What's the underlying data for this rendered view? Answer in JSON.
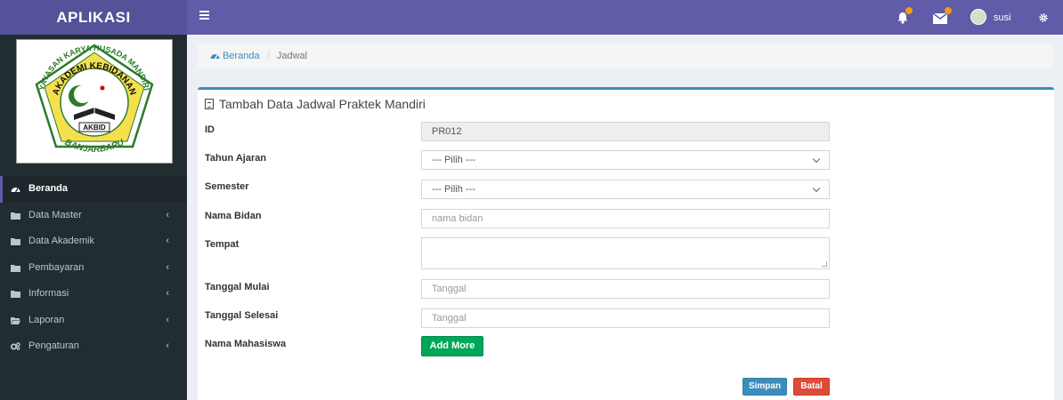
{
  "header": {
    "app_title": "APLIKASI",
    "user_name": "susi"
  },
  "logo": {
    "ring_text": "YAYASAN KARYA HUSADA MANDIRI",
    "inner_text": "AKADEMI KEBIDANAN",
    "badge_text": "AKBID",
    "city_text": "BANJARBARU"
  },
  "sidebar": {
    "items": [
      {
        "label": "Beranda",
        "icon": "dashboard-icon"
      },
      {
        "label": "Data Master",
        "icon": "folder-icon"
      },
      {
        "label": "Data Akademik",
        "icon": "folder-icon"
      },
      {
        "label": "Pembayaran",
        "icon": "folder-icon"
      },
      {
        "label": "Informasi",
        "icon": "folder-icon"
      },
      {
        "label": "Laporan",
        "icon": "folder-open-icon"
      },
      {
        "label": "Pengaturan",
        "icon": "cogs-icon"
      }
    ],
    "chevron": "‹"
  },
  "breadcrumb": {
    "home": "Beranda",
    "separator": "/",
    "current": "Jadwal"
  },
  "form": {
    "title": "Tambah Data Jadwal Praktek Mandiri",
    "id_label": "ID",
    "id_value": "PR012",
    "tahun_label": "Tahun Ajaran",
    "tahun_selected": "--- Pilih ---",
    "semester_label": "Semester",
    "semester_selected": "--- Pilih ---",
    "bidan_label": "Nama Bidan",
    "bidan_placeholder": "nama bidan",
    "tempat_label": "Tempat",
    "mulai_label": "Tanggal Mulai",
    "mulai_placeholder": "Tanggal",
    "selesai_label": "Tanggal Selesai",
    "selesai_placeholder": "Tanggal",
    "mahasiswa_label": "Nama Mahasiswa",
    "add_more_label": "Add More",
    "save_label": "Simpan",
    "cancel_label": "Batal"
  },
  "colors": {
    "header": "#605ca8",
    "logo_bg": "#555299",
    "sidebar": "#222d32",
    "primary": "#3c8dbc",
    "success": "#00a65a",
    "danger": "#dd4b39",
    "badge": "#f39c12"
  }
}
